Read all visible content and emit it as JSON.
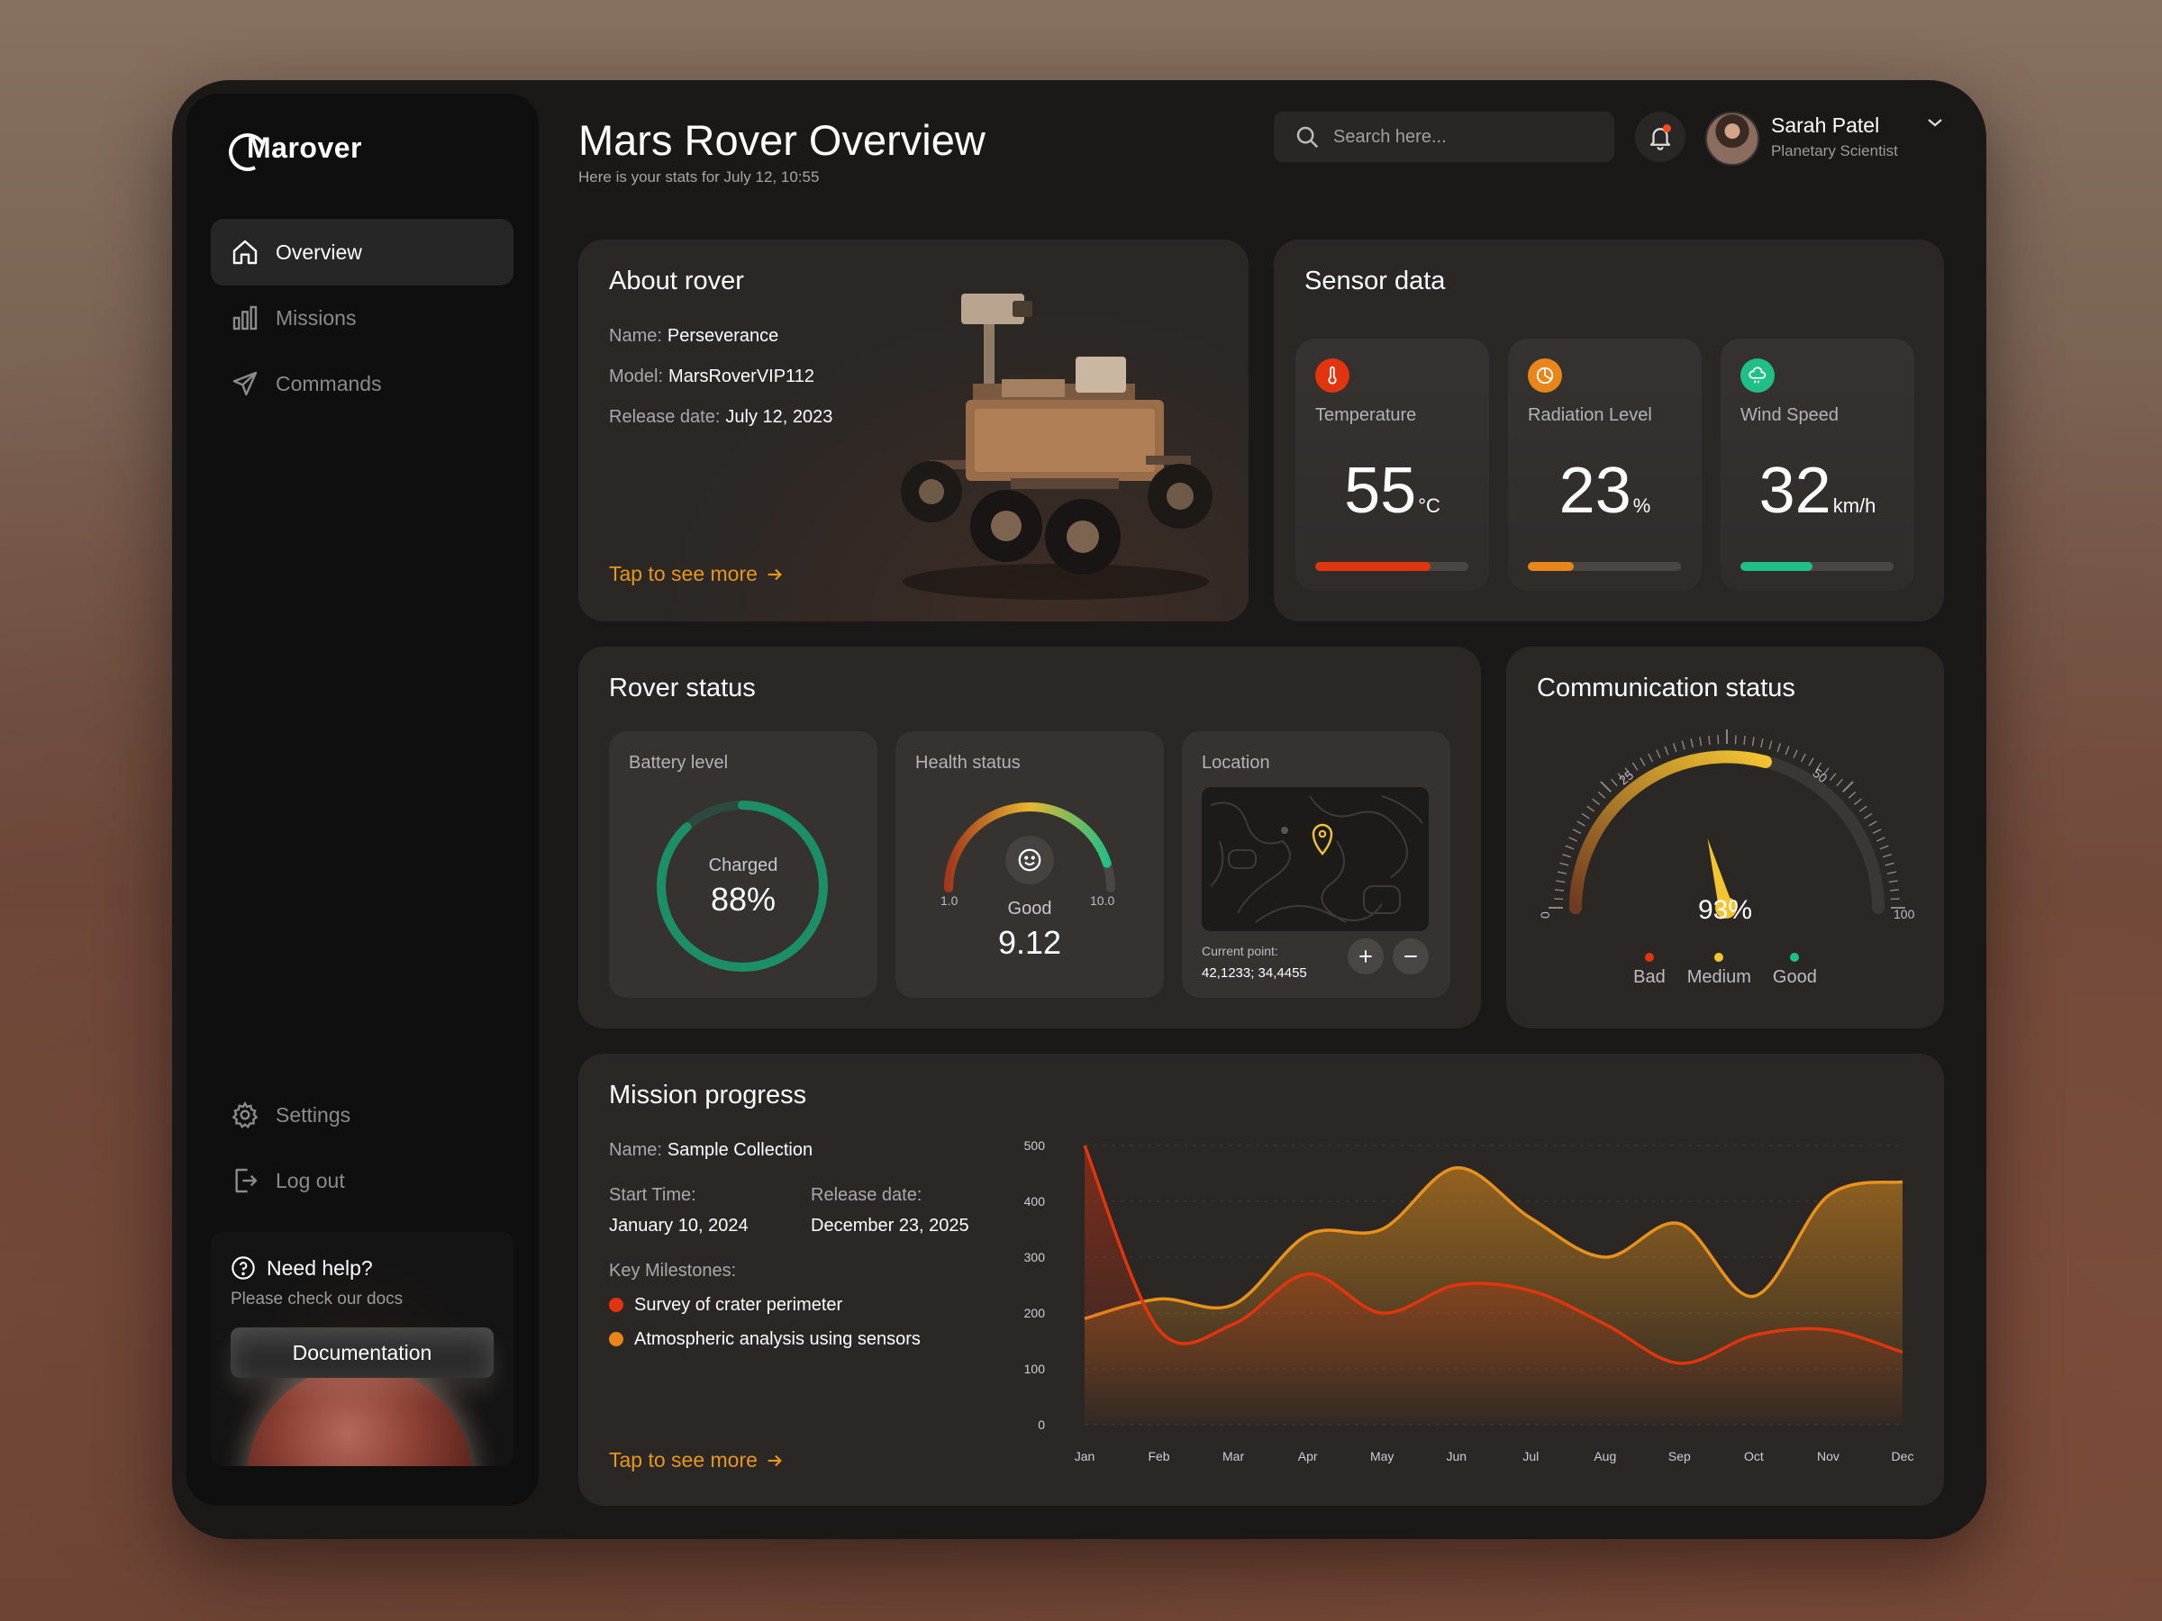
{
  "brand": {
    "name": "Marover"
  },
  "sidebar": {
    "items": [
      {
        "label": "Overview"
      },
      {
        "label": "Missions"
      },
      {
        "label": "Commands"
      }
    ],
    "bottom": [
      {
        "label": "Settings"
      },
      {
        "label": "Log out"
      }
    ],
    "help": {
      "title": "Need help?",
      "text": "Please check our docs",
      "button": "Documentation"
    }
  },
  "header": {
    "title": "Mars Rover Overview",
    "subtitle": "Here is your stats for July 12, 10:55",
    "search_placeholder": "Search here...",
    "user": {
      "name": "Sarah Patel",
      "role": "Planetary Scientist"
    }
  },
  "about": {
    "title": "About rover",
    "name_label": "Name:",
    "name": "Perseverance",
    "model_label": "Model:",
    "model": "MarsRoverVIP112",
    "release_label": "Release date:",
    "release": "July 12, 2023",
    "link": "Tap to see more"
  },
  "sensor": {
    "title": "Sensor data",
    "tiles": [
      {
        "label": "Temperature",
        "value": "55",
        "unit": "°C",
        "level": 0.75,
        "color": "#e0350f"
      },
      {
        "label": "Radiation Level",
        "value": "23",
        "unit": "%",
        "level": 0.3,
        "color": "#e8861c"
      },
      {
        "label": "Wind Speed",
        "value": "32",
        "unit": "km/h",
        "level": 0.47,
        "color": "#1fbf86"
      }
    ]
  },
  "rover_status": {
    "title": "Rover status",
    "battery": {
      "label": "Battery level",
      "state": "Charged",
      "value": "88%",
      "level": 0.88
    },
    "health": {
      "label": "Health status",
      "state": "Good",
      "value": "9.12",
      "min": "1.0",
      "max": "10.0",
      "level": 0.901
    },
    "location": {
      "label": "Location",
      "point_label": "Current point:",
      "point": "42,1233; 34,4455"
    }
  },
  "communication": {
    "title": "Communication status",
    "value": "93%",
    "ticks": [
      "0",
      "25",
      "50",
      "100"
    ],
    "legend": [
      {
        "label": "Bad",
        "color": "#e0350f"
      },
      {
        "label": "Medium",
        "color": "#f2c531"
      },
      {
        "label": "Good",
        "color": "#1fbf86"
      }
    ]
  },
  "mission": {
    "title": "Mission progress",
    "name_label": "Name:",
    "name": "Sample Collection",
    "start_label": "Start Time:",
    "start": "January 10, 2024",
    "release_label": "Release date:",
    "release": "December 23, 2025",
    "milestones_label": "Key Milestones:",
    "milestones": [
      {
        "label": "Survey of crater perimeter",
        "color": "#e0350f"
      },
      {
        "label": "Atmospheric analysis using sensors",
        "color": "#e8861c"
      }
    ],
    "link": "Tap to see more"
  },
  "chart_data": {
    "type": "area",
    "categories": [
      "Jan",
      "Feb",
      "Mar",
      "Apr",
      "May",
      "Jun",
      "Jul",
      "Aug",
      "Sep",
      "Oct",
      "Nov",
      "Dec"
    ],
    "ylim": [
      0,
      500
    ],
    "yticks": [
      0,
      100,
      200,
      300,
      400,
      500
    ],
    "series": [
      {
        "color": "#e8921c",
        "values": [
          190,
          225,
          215,
          340,
          350,
          460,
          370,
          300,
          360,
          230,
          410,
          435
        ]
      },
      {
        "color": "#e0350f",
        "values": [
          500,
          170,
          180,
          270,
          200,
          250,
          240,
          180,
          110,
          160,
          170,
          130
        ]
      }
    ]
  }
}
